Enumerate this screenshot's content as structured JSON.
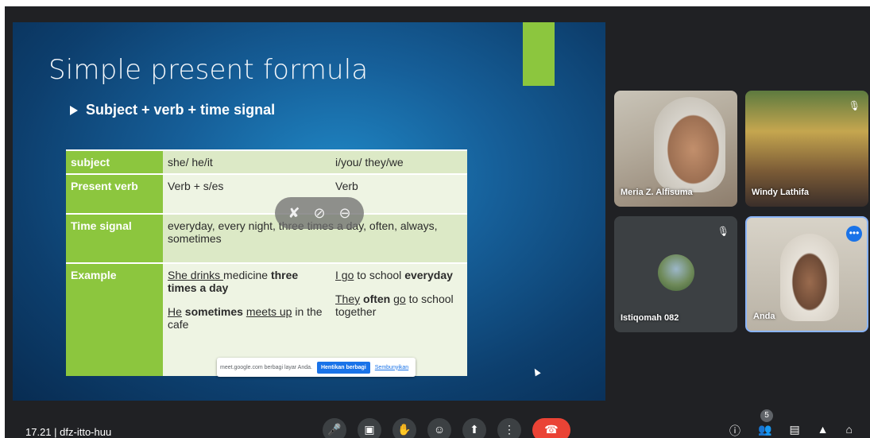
{
  "slide": {
    "title": "Simple present formula",
    "bullet": "Subject + verb + time signal",
    "table": {
      "subject": {
        "label": "subject",
        "col1": "she/ he/it",
        "col2": "i/you/ they/we"
      },
      "present_verb": {
        "label": "Present verb",
        "col1": "Verb + s/es",
        "col2": "Verb"
      },
      "time_signal": {
        "label": "Time signal",
        "text": "everyday, every night, three times a day, often, always, sometimes"
      },
      "example": {
        "label": "Example",
        "col1_a1": "She drinks ",
        "col1_a2": "medicine ",
        "col1_a3": "three times a day",
        "col1_b1": "He",
        "col1_b2": " sometimes ",
        "col1_b3": "meets up",
        "col1_b4": " in the cafe",
        "col2_a1": "I go",
        "col2_a2": " to school ",
        "col2_a3": "everyday",
        "col2_b1": "They",
        "col2_b2": " often ",
        "col2_b3": "go",
        "col2_b4": " to school together"
      }
    },
    "share_banner": {
      "text": "meet.google.com berbagi layar Anda.",
      "stop_label": "Hentikan berbagi",
      "hide_label": "Sembunyikan"
    }
  },
  "participants": [
    {
      "name": "Meria Z. Alfisuma"
    },
    {
      "name": "Windy Lathifa"
    },
    {
      "name": "Istiqomah 082"
    },
    {
      "name": "Anda"
    }
  ],
  "bottom_bar": {
    "time": "17.21",
    "meeting_code": "dfz-itto-huu",
    "people_count": "5"
  },
  "colors": {
    "accent_green": "#8cc63e",
    "end_call_red": "#ea4335",
    "meet_bg": "#202124"
  }
}
